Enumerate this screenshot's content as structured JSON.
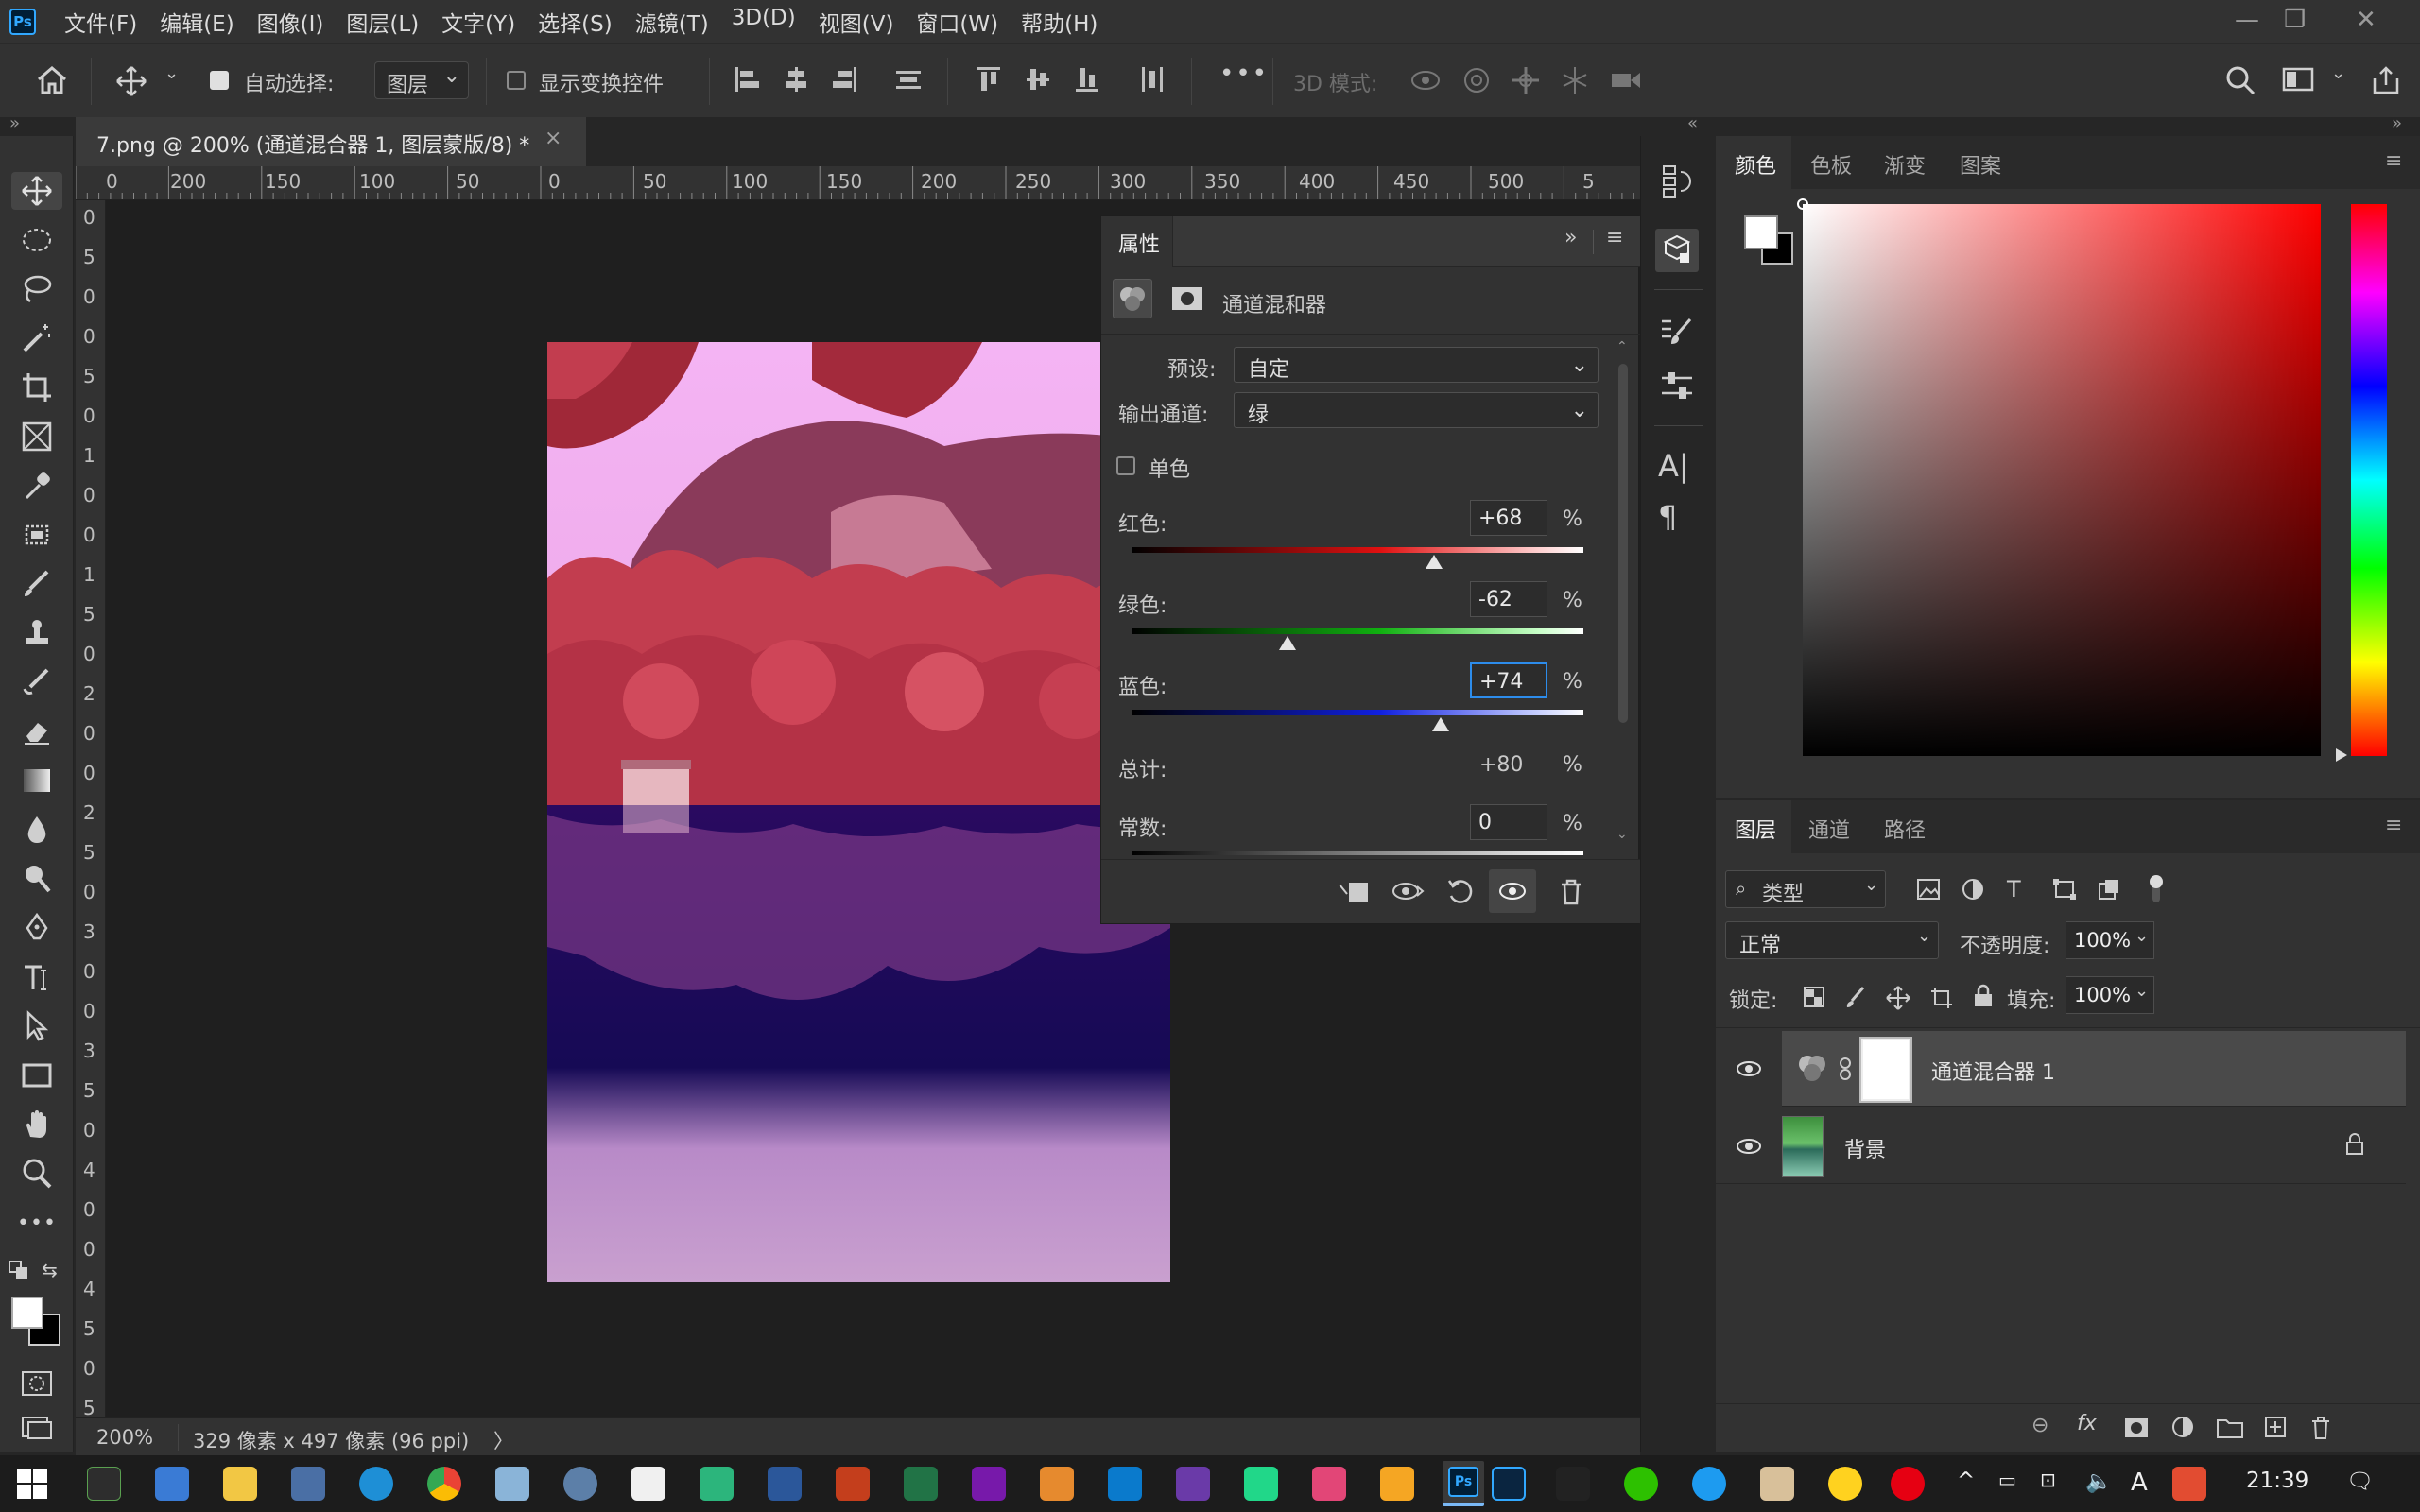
{
  "app": {
    "logo": "Ps"
  },
  "menu": [
    "文件(F)",
    "编辑(E)",
    "图像(I)",
    "图层(L)",
    "文字(Y)",
    "选择(S)",
    "滤镜(T)",
    "3D(D)",
    "视图(V)",
    "窗口(W)",
    "帮助(H)"
  ],
  "options": {
    "auto_select_label": "自动选择:",
    "auto_select_value": "图层",
    "show_transform_label": "显示变换控件",
    "more": "•••",
    "mode_3d_label": "3D 模式:"
  },
  "document": {
    "tab_title": "7.png @ 200% (通道混合器 1, 图层蒙版/8) *",
    "close": "×"
  },
  "rulers": {
    "h_ticks": [
      "0",
      "200",
      "150",
      "100",
      "50",
      "0",
      "50",
      "100",
      "150",
      "200",
      "250",
      "300",
      "350",
      "400",
      "450",
      "500",
      "5"
    ],
    "v_ticks": [
      "0",
      "5",
      "0",
      "0",
      "5",
      "0",
      "1",
      "0",
      "0",
      "1",
      "5",
      "0",
      "2",
      "0",
      "0",
      "2",
      "5",
      "0",
      "3",
      "0",
      "0",
      "3",
      "5",
      "0",
      "4",
      "0",
      "0",
      "4",
      "5",
      "0",
      "5"
    ]
  },
  "status": {
    "zoom": "200%",
    "doc_info": "329 像素 x 497 像素 (96 ppi)",
    "arrow": "〉"
  },
  "properties": {
    "title": "属性",
    "adjustment_name": "通道混和器",
    "preset_label": "预设:",
    "preset_value": "自定",
    "output_channel_label": "输出通道:",
    "output_channel_value": "绿",
    "monochrome_label": "单色",
    "red_label": "红色:",
    "red_value": "+68",
    "red_pct": 0.68,
    "green_label": "绿色:",
    "green_value": "-62",
    "green_pct": -0.62,
    "blue_label": "蓝色:",
    "blue_value": "+74",
    "blue_pct": 0.74,
    "total_label": "总计:",
    "total_value": "+80",
    "constant_label": "常数:",
    "constant_value": "0",
    "percent": "%"
  },
  "color_panel": {
    "tabs": [
      "颜色",
      "色板",
      "渐变",
      "图案"
    ],
    "active_tab": 0,
    "foreground": "#ffffff",
    "background": "#000000"
  },
  "layers_panel": {
    "tabs": [
      "图层",
      "通道",
      "路径"
    ],
    "filter_label": "类型",
    "blend_mode": "正常",
    "opacity_label": "不透明度:",
    "opacity_value": "100%",
    "lock_label": "锁定:",
    "fill_label": "填充:",
    "fill_value": "100%",
    "layers": [
      {
        "name": "通道混合器 1",
        "selected": true
      },
      {
        "name": "背景",
        "selected": false
      }
    ]
  },
  "taskbar": {
    "clock": "21:39",
    "ime": "A"
  }
}
